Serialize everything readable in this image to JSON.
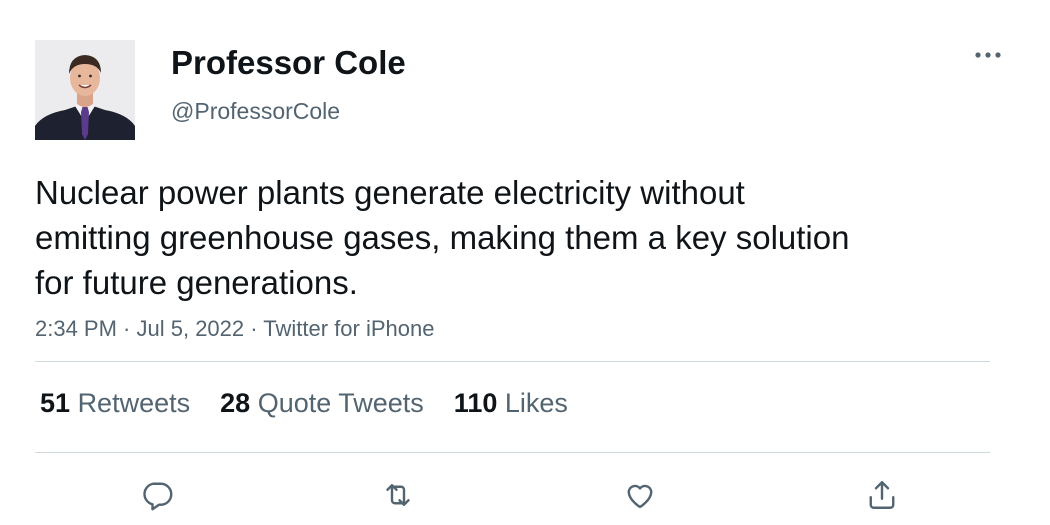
{
  "user": {
    "display_name": "Professor Cole",
    "handle": "@ProfessorCole",
    "avatar_icon": "profile-photo"
  },
  "tweet": {
    "text": "Nuclear power plants generate electricity without\nemitting greenhouse gases, making them a key solution\nfor future generations.",
    "time": "2:34 PM",
    "separator": " · ",
    "date": "Jul 5, 2022",
    "source": "Twitter for iPhone"
  },
  "stats": {
    "retweets_count": "51",
    "retweets_label": "Retweets",
    "quote_tweets_count": "28",
    "quote_tweets_label": "Quote Tweets",
    "likes_count": "110",
    "likes_label": "Likes"
  },
  "actions": [
    {
      "icon": "reply-icon"
    },
    {
      "icon": "retweet-icon"
    },
    {
      "icon": "like-icon"
    },
    {
      "icon": "share-icon"
    }
  ],
  "colors": {
    "text_primary": "#0f1419",
    "text_secondary": "#536471",
    "divider": "#cfd9de",
    "tie": "#5b3b8c"
  }
}
